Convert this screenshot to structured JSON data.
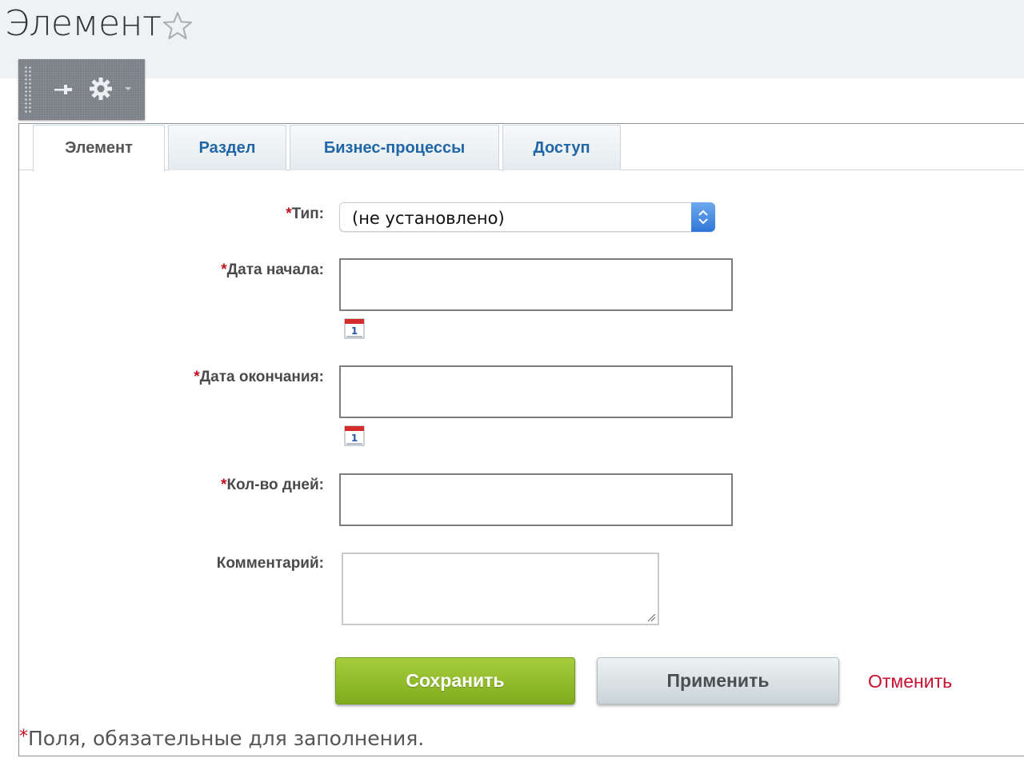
{
  "page": {
    "title": "Элемент"
  },
  "tabs": [
    {
      "label": "Элемент",
      "active": true
    },
    {
      "label": "Раздел",
      "active": false
    },
    {
      "label": "Бизнес-процессы",
      "active": false
    },
    {
      "label": "Доступ",
      "active": false
    }
  ],
  "form": {
    "required_marker": "*",
    "type": {
      "label": "Тип:",
      "required": true,
      "value": "(не установлено)"
    },
    "start_date": {
      "label": "Дата начала:",
      "required": true,
      "value": ""
    },
    "end_date": {
      "label": "Дата окончания:",
      "required": true,
      "value": ""
    },
    "days_count": {
      "label": "Кол-во дней:",
      "required": true,
      "value": ""
    },
    "comment": {
      "label": "Комментарий:",
      "required": false,
      "value": ""
    }
  },
  "buttons": {
    "save": "Сохранить",
    "apply": "Применить",
    "cancel": "Отменить"
  },
  "footnote": {
    "marker": "*",
    "text": "Поля, обязательные для заполнения."
  },
  "icons": {
    "favorite": "star-icon",
    "pin": "pin-icon",
    "settings": "gear-icon",
    "menu": "chevron-down-icon",
    "calendar": "calendar-icon"
  },
  "colors": {
    "accent_blue": "#2066a6",
    "required_red": "#c01020",
    "save_green": "#8cb82a",
    "cancel_red": "#c8102e"
  }
}
